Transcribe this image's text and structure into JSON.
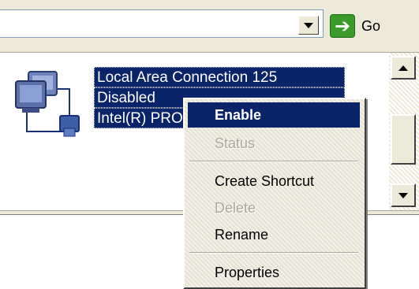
{
  "address_bar": {
    "go_label": "Go"
  },
  "connection": {
    "name": "Local Area Connection 125",
    "status": "Disabled",
    "device": "Intel(R) PRO"
  },
  "context_menu": {
    "items": [
      {
        "label": "Enable",
        "state": "highlighted"
      },
      {
        "label": "Status",
        "state": "disabled"
      },
      {
        "label": "Create Shortcut",
        "state": "normal"
      },
      {
        "label": "Delete",
        "state": "disabled"
      },
      {
        "label": "Rename",
        "state": "normal"
      },
      {
        "label": "Properties",
        "state": "normal"
      }
    ]
  },
  "colors": {
    "selection": "#0a246a",
    "face": "#ece9d8",
    "go_green": "#3a9a2a",
    "disabled_text": "#aca899"
  },
  "icons": {
    "network_connection": "network-connection-icon",
    "go": "go-arrow-icon",
    "dropdown": "chevron-down-icon"
  }
}
